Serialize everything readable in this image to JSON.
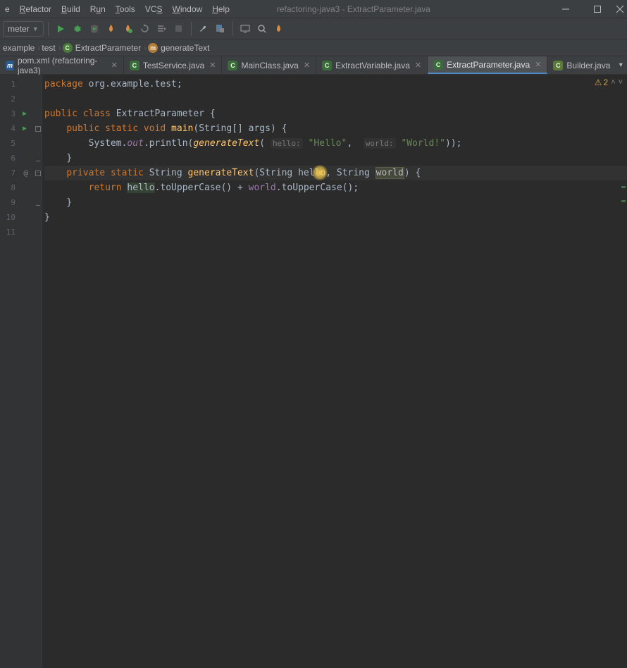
{
  "menu": {
    "items": [
      "e",
      "Refactor",
      "Build",
      "Run",
      "Tools",
      "VCS",
      "Window",
      "Help"
    ],
    "underlines": [
      "",
      "R",
      "B",
      "R",
      "T",
      "S",
      "W",
      "H"
    ]
  },
  "window_title": "refactoring-java3 - ExtractParameter.java",
  "toolbar": {
    "run_config": "meter"
  },
  "breadcrumbs": [
    {
      "label": "example",
      "icon": ""
    },
    {
      "label": "test",
      "icon": ""
    },
    {
      "label": "ExtractParameter",
      "icon": "class"
    },
    {
      "label": "generateText",
      "icon": "method"
    }
  ],
  "tabs": [
    {
      "label": "pom.xml (refactoring-java3)",
      "icon": "maven",
      "glyph": "m",
      "active": false
    },
    {
      "label": "TestService.java",
      "icon": "java",
      "glyph": "C",
      "active": false
    },
    {
      "label": "MainClass.java",
      "icon": "java",
      "glyph": "C",
      "active": false
    },
    {
      "label": "ExtractVariable.java",
      "icon": "java",
      "glyph": "C",
      "active": false
    },
    {
      "label": "ExtractParameter.java",
      "icon": "java",
      "glyph": "C",
      "active": true
    },
    {
      "label": "Builder.java",
      "icon": "builder",
      "glyph": "C",
      "active": false,
      "noclose": true
    }
  ],
  "inspections": {
    "warn_count": "2"
  },
  "code": {
    "lines": [
      {
        "n": "1"
      },
      {
        "n": "2"
      },
      {
        "n": "3",
        "run": true
      },
      {
        "n": "4",
        "run": true,
        "fold": "-"
      },
      {
        "n": "5"
      },
      {
        "n": "6",
        "fold": "e"
      },
      {
        "n": "7",
        "at": true,
        "fold": "-"
      },
      {
        "n": "8"
      },
      {
        "n": "9",
        "fold": "e"
      },
      {
        "n": "10"
      },
      {
        "n": "11"
      }
    ],
    "t": {
      "package": "package",
      "pkg_name": "org.example.test",
      "semi": ";",
      "public": "public",
      "class": "class",
      "className": "ExtractParameter",
      "lbrace": "{",
      "rbrace": "}",
      "static": "static",
      "void": "void",
      "main": "main",
      "stringArr": "String[]",
      "args": "args",
      "rparen": ")",
      "system": "System",
      "out": "out",
      "println": "println",
      "generateText": "generateText",
      "hint_hello": "hello:",
      "str_hello": "\"Hello\"",
      "comma": ",",
      "hint_world": "world:",
      "str_world": "\"World!\"",
      "rparen2": "))",
      "private": "private",
      "String": "String",
      "param_hello": "hello",
      "param_world": "world",
      "return": "return",
      "hello_var": "hello",
      "toUpper": "toUpperCase()",
      "plus": " + ",
      "world_var": "world"
    }
  }
}
